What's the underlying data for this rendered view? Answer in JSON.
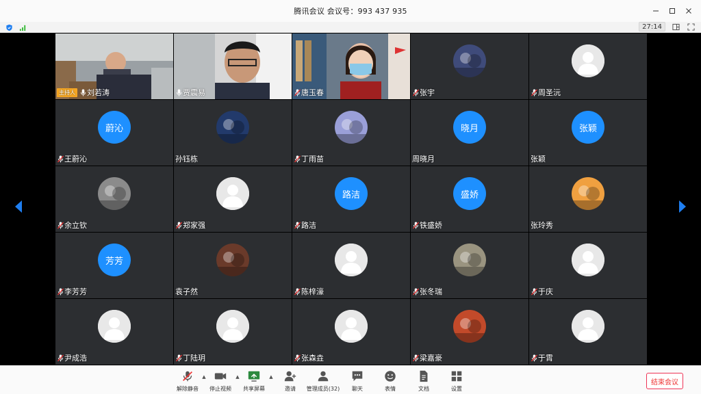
{
  "window": {
    "title": "腾讯会议 会议号：993 437 935"
  },
  "status": {
    "timer": "27:14"
  },
  "participants": [
    {
      "name": "刘若涛",
      "type": "video",
      "host": true,
      "host_label": "主持人",
      "mic": "on"
    },
    {
      "name": "贾震易",
      "type": "video",
      "mic": "on"
    },
    {
      "name": "唐玉春",
      "type": "video",
      "mic": "muted"
    },
    {
      "name": "张宇",
      "type": "photo",
      "mic": "muted",
      "avatar_color": "#3f4b7a"
    },
    {
      "name": "周圣沅",
      "type": "default",
      "mic": "muted"
    },
    {
      "name": "王蔚沁",
      "type": "text",
      "avatar_text": "蔚沁",
      "mic": "muted"
    },
    {
      "name": "孙钰栋",
      "type": "photo",
      "mic": "none",
      "avatar_color": "#223a6b"
    },
    {
      "name": "丁雨苗",
      "type": "photo",
      "mic": "muted",
      "avatar_color": "#9a9fd8"
    },
    {
      "name": "周晓月",
      "type": "text",
      "avatar_text": "晓月",
      "mic": "none"
    },
    {
      "name": "张颖",
      "type": "text",
      "avatar_text": "张颖",
      "mic": "none"
    },
    {
      "name": "余立钦",
      "type": "photo",
      "mic": "muted",
      "avatar_color": "#8b8b8b"
    },
    {
      "name": "郑家强",
      "type": "default",
      "mic": "muted"
    },
    {
      "name": "路洁",
      "type": "text",
      "avatar_text": "路洁",
      "mic": "muted"
    },
    {
      "name": "铁盛娇",
      "type": "text",
      "avatar_text": "盛娇",
      "mic": "muted"
    },
    {
      "name": "张玲秀",
      "type": "photo",
      "mic": "none",
      "avatar_color": "#f0a040"
    },
    {
      "name": "李芳芳",
      "type": "text",
      "avatar_text": "芳芳",
      "mic": "muted"
    },
    {
      "name": "袁子然",
      "type": "photo",
      "mic": "none",
      "avatar_color": "#6a3a2a"
    },
    {
      "name": "陈梓濠",
      "type": "default",
      "mic": "muted"
    },
    {
      "name": "张冬瑞",
      "type": "photo",
      "mic": "muted",
      "avatar_color": "#9a9480"
    },
    {
      "name": "于庆",
      "type": "default",
      "mic": "muted"
    },
    {
      "name": "尹成浩",
      "type": "default",
      "mic": "muted"
    },
    {
      "name": "丁陆玥",
      "type": "default",
      "mic": "muted"
    },
    {
      "name": "张森垚",
      "type": "default",
      "mic": "muted"
    },
    {
      "name": "梁嘉豪",
      "type": "photo",
      "mic": "muted",
      "avatar_color": "#c24a2a"
    },
    {
      "name": "于霄",
      "type": "default",
      "mic": "muted"
    }
  ],
  "toolbar": {
    "unmute": "解除静音",
    "stop_video": "停止视频",
    "share_screen": "共享屏幕",
    "invite": "邀请",
    "manage_members": "管理成员(32)",
    "chat": "聊天",
    "reactions": "表情",
    "documents": "文档",
    "settings": "设置",
    "end_meeting": "结束会议"
  },
  "colors": {
    "avatar_blue": "#1e90ff",
    "end_red": "#e33333",
    "host_badge": "#f5a623",
    "tile_bg": "#2c2e31",
    "nav_blue": "#1e7ef0"
  }
}
